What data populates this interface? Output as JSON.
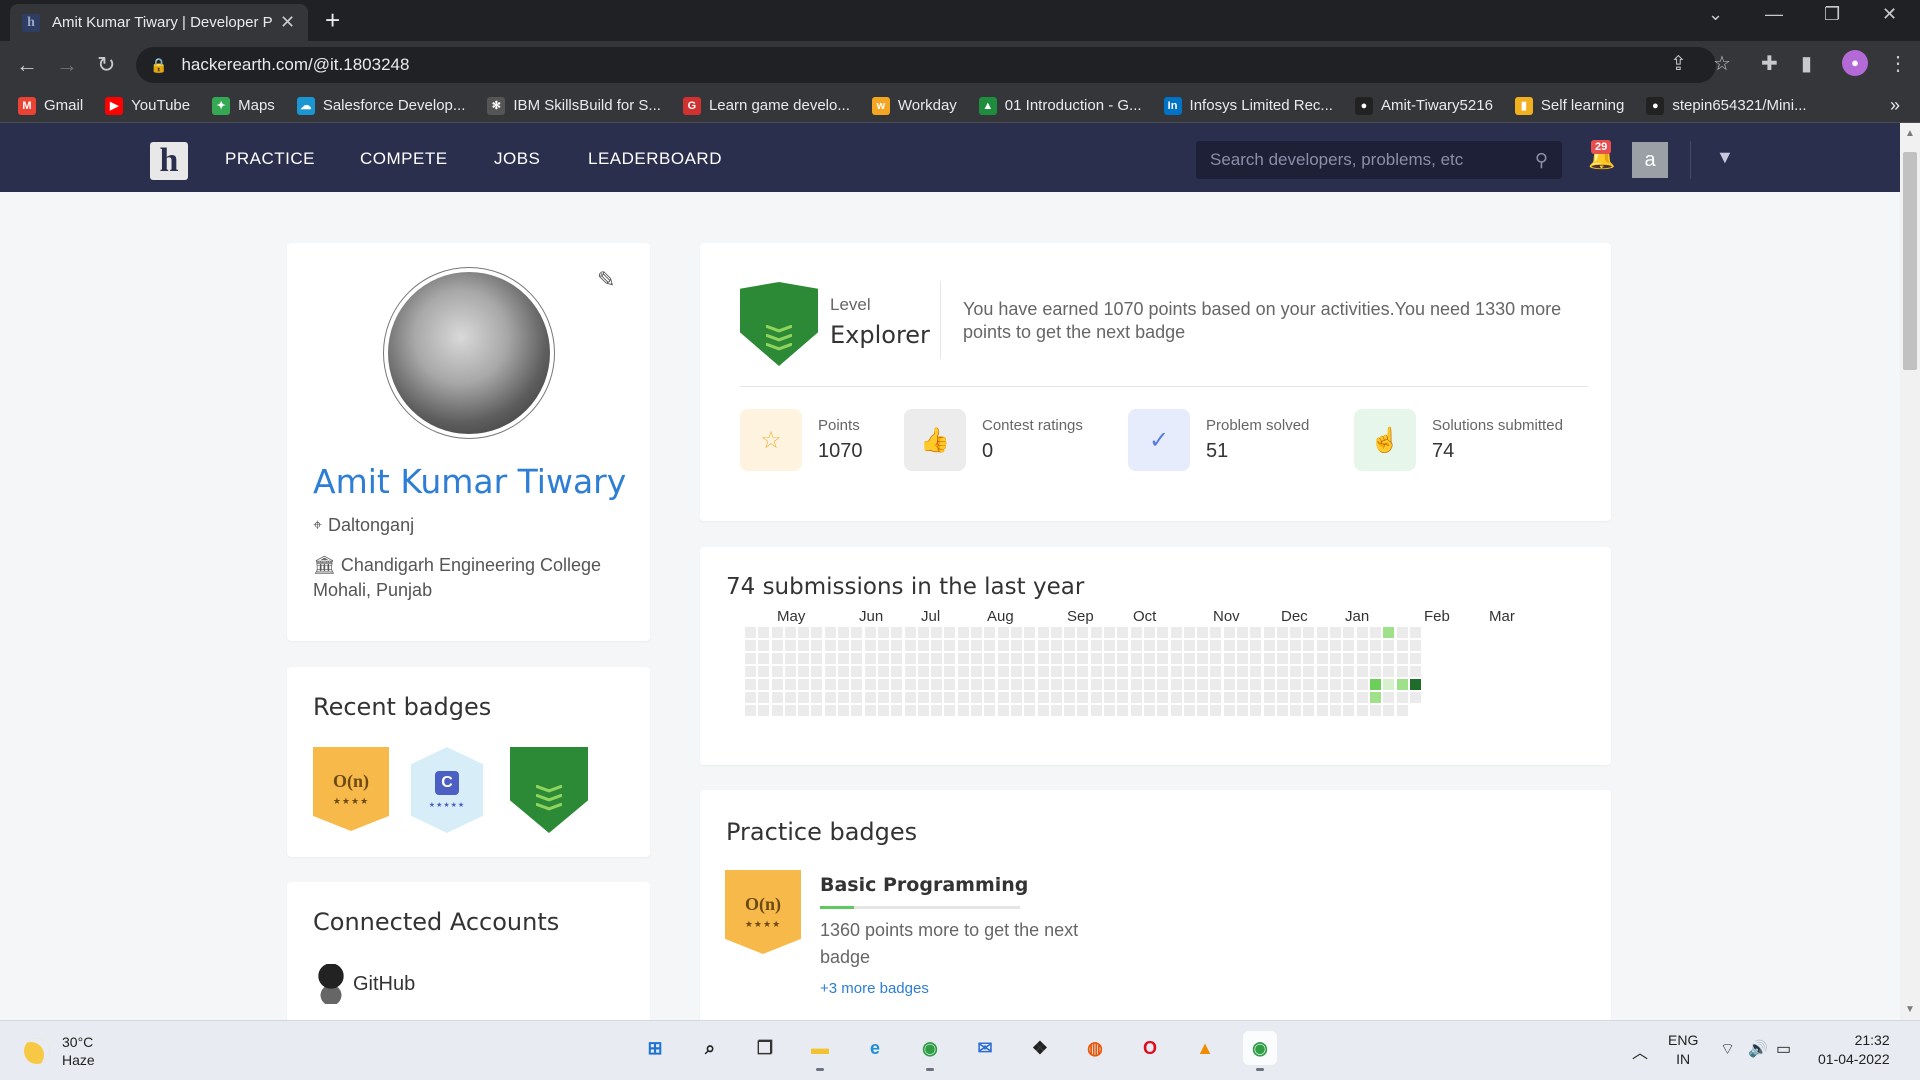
{
  "browser": {
    "tab_title": "Amit Kumar Tiwary | Developer P",
    "tab_favicon": "h",
    "url": "hackerearth.com/@it.1803248",
    "bookmarks": [
      {
        "label": "Gmail",
        "icon": "gmail-icon",
        "color": "#ea4335",
        "glyph": "M"
      },
      {
        "label": "YouTube",
        "icon": "youtube-icon",
        "color": "#ff0000",
        "glyph": "▶"
      },
      {
        "label": "Maps",
        "icon": "maps-icon",
        "color": "#34a853",
        "glyph": "✦"
      },
      {
        "label": "Salesforce Develop...",
        "icon": "salesforce-icon",
        "color": "#1b96d3",
        "glyph": "☁"
      },
      {
        "label": "IBM SkillsBuild for S...",
        "icon": "ibm-icon",
        "color": "#555555",
        "glyph": "✻"
      },
      {
        "label": "Learn game develo...",
        "icon": "game-dev-icon",
        "color": "#d03232",
        "glyph": "G"
      },
      {
        "label": "Workday",
        "icon": "workday-icon",
        "color": "#f4a623",
        "glyph": "w"
      },
      {
        "label": "01 Introduction - G...",
        "icon": "drive-icon",
        "color": "#1e8e3e",
        "glyph": "▲"
      },
      {
        "label": "Infosys Limited Rec...",
        "icon": "infosys-icon",
        "color": "#0073c7",
        "glyph": "In"
      },
      {
        "label": "Amit-Tiwary5216",
        "icon": "github-bookmark-icon",
        "color": "#222222",
        "glyph": "●"
      },
      {
        "label": "Self learning",
        "icon": "self-learning-icon",
        "color": "#f2b01e",
        "glyph": "▮"
      },
      {
        "label": "stepin654321/Mini...",
        "icon": "github-bookmark-icon",
        "color": "#222222",
        "glyph": "●"
      }
    ],
    "bookmarks_more": "»"
  },
  "site": {
    "logo": "h",
    "nav": [
      "PRACTICE",
      "COMPETE",
      "JOBS",
      "LEADERBOARD"
    ],
    "search_placeholder": "Search developers, problems, etc",
    "notification_count": "29",
    "avatar_letter": "a"
  },
  "profile": {
    "name": "Amit Kumar Tiwary",
    "location": "Daltonganj",
    "college": "Chandigarh Engineering College Mohali, Punjab"
  },
  "recent_badges": {
    "title": "Recent badges",
    "badges": [
      {
        "type": "gold",
        "label": "O(n)",
        "stars": "★★★★"
      },
      {
        "type": "c",
        "label": "C",
        "stars": "★★★★★"
      },
      {
        "type": "green",
        "label": ""
      }
    ]
  },
  "connected": {
    "title": "Connected Accounts",
    "github_label": "GitHub"
  },
  "level": {
    "label": "Level",
    "name": "Explorer",
    "message": "You have earned 1070 points based on your activities.You need 1330 more points to get the next badge"
  },
  "stats": [
    {
      "label": "Points",
      "value": "1070",
      "icon": "star-icon",
      "bg": "#fdf3df",
      "fg": "#f2b445",
      "glyph": "☆"
    },
    {
      "label": "Contest ratings",
      "value": "0",
      "icon": "thumbs-up-icon",
      "bg": "#ececec",
      "fg": "#8a8a8a",
      "glyph": "👍"
    },
    {
      "label": "Problem solved",
      "value": "51",
      "icon": "check-circle-icon",
      "bg": "#e6ecfb",
      "fg": "#5a7be0",
      "glyph": "✓"
    },
    {
      "label": "Solutions submitted",
      "value": "74",
      "icon": "pointer-hand-icon",
      "bg": "#e6f6ea",
      "fg": "#4fbf6a",
      "glyph": "☝"
    }
  ],
  "heatmap": {
    "title": "74 submissions in the last year",
    "months": [
      "May",
      "Jun",
      "Jul",
      "Aug",
      "Sep",
      "Oct",
      "Nov",
      "Dec",
      "Jan",
      "Feb",
      "Mar"
    ],
    "empty_color": "#ebebeb",
    "active_cells": [
      {
        "week": 48,
        "day": 0,
        "color": "#9fe08a"
      },
      {
        "week": 47,
        "day": 4,
        "color": "#6ccf5a"
      },
      {
        "week": 47,
        "day": 5,
        "color": "#9fe08a"
      },
      {
        "week": 48,
        "day": 4,
        "color": "#d7f1cf"
      },
      {
        "week": 49,
        "day": 4,
        "color": "#9fe08a"
      },
      {
        "week": 50,
        "day": 4,
        "color": "#1e6b2a"
      }
    ]
  },
  "practice_badges": {
    "title": "Practice badges",
    "badge_label": "O(n)",
    "badge_stars": "★★★★",
    "name": "Basic Programming",
    "progress": 0.17,
    "description": "1360 points more to get the next badge",
    "more_link": "+3 more badges"
  },
  "taskbar": {
    "temperature": "30°C",
    "weather": "Haze",
    "lang_top": "ENG",
    "lang_bottom": "IN",
    "time": "21:32",
    "date": "01-04-2022",
    "apps": [
      {
        "icon": "windows-start-icon",
        "color": "#1f74d2",
        "glyph": "⊞",
        "active": false
      },
      {
        "icon": "search-icon",
        "color": "#222222",
        "glyph": "⌕",
        "active": false
      },
      {
        "icon": "task-view-icon",
        "color": "#333333",
        "glyph": "❐",
        "active": false
      },
      {
        "icon": "file-explorer-icon",
        "color": "#f1c232",
        "glyph": "▬",
        "active": false
      },
      {
        "icon": "edge-icon",
        "color": "#1e8fd6",
        "glyph": "e",
        "active": false
      },
      {
        "icon": "chrome-icon",
        "color": "#2f9e44",
        "glyph": "◉",
        "active": false
      },
      {
        "icon": "mail-icon",
        "color": "#2f6fd6",
        "glyph": "✉",
        "active": false
      },
      {
        "icon": "dropbox-icon",
        "color": "#222222",
        "glyph": "❖",
        "active": false
      },
      {
        "icon": "firefox-icon",
        "color": "#e8590c",
        "glyph": "◍",
        "active": false
      },
      {
        "icon": "opera-icon",
        "color": "#e00b1c",
        "glyph": "O",
        "active": false
      },
      {
        "icon": "vlc-icon",
        "color": "#f08c00",
        "glyph": "▲",
        "active": false
      },
      {
        "icon": "chrome-profile-icon",
        "color": "#2f9e44",
        "glyph": "◉",
        "active": true
      }
    ]
  }
}
